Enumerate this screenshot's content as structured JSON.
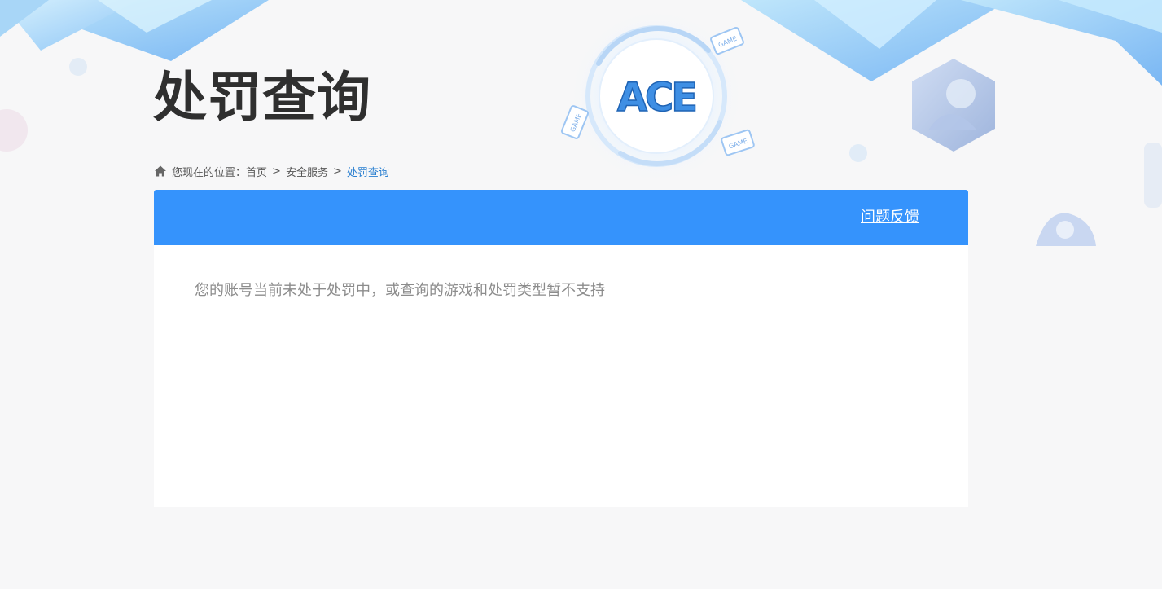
{
  "page": {
    "title": "处罚查询"
  },
  "breadcrumb": {
    "prefix": "您现在的位置：",
    "items": [
      {
        "label": "首页"
      },
      {
        "label": "安全服务"
      },
      {
        "label": "处罚查询"
      }
    ],
    "separator": ">"
  },
  "panel": {
    "feedback_label": "问题反馈",
    "message": "您的账号当前未处于处罚中，或查询的游戏和处罚类型暂不支持"
  },
  "logo": {
    "text": "ACE",
    "badge_text": "GAME"
  },
  "colors": {
    "header_blue": "#3593fc",
    "breadcrumb_current": "#2a7fd0",
    "title": "#2f2f2f",
    "message": "#8c8c8c"
  },
  "icons": {
    "home": "home-icon"
  }
}
